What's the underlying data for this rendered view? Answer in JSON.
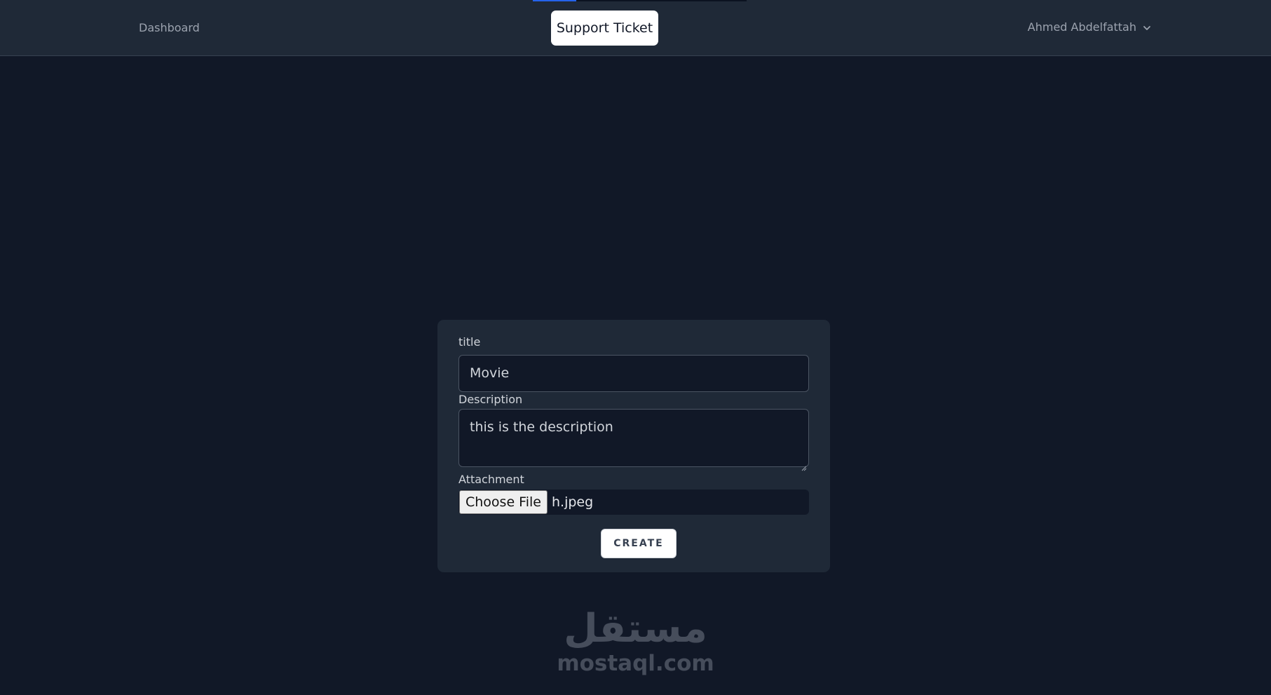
{
  "navbar": {
    "dashboard_label": "Dashboard",
    "support_ticket_label": "Support Ticket",
    "user_name": "Ahmed Abdelfattah",
    "user_menu_icon": "chevron-down-icon"
  },
  "form": {
    "title_label": "title",
    "title_value": "Movie",
    "description_label": "Description",
    "description_value": "this is the description",
    "attachment_label": "Attachment",
    "choose_file_label": "Choose File",
    "file_name": "h.jpeg",
    "create_label": "CREATE"
  },
  "watermark": {
    "arabic_text": "مستقل",
    "latin_text": "mostaql.com"
  },
  "colors": {
    "page_background": "#111827",
    "navbar_background": "#1f2937",
    "card_background": "#1f2937",
    "accent": "#2563eb"
  }
}
